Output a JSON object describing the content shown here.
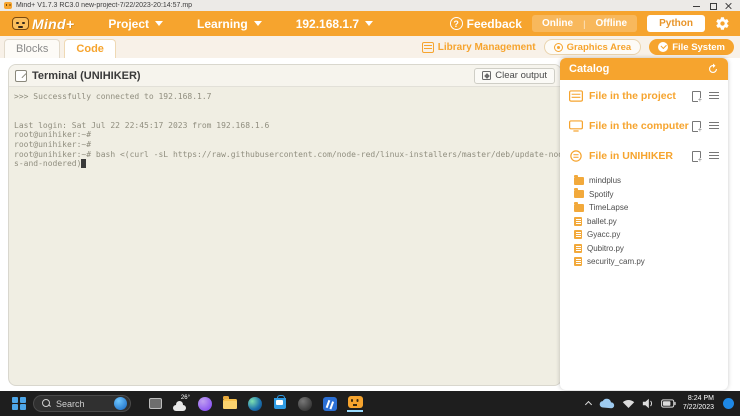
{
  "window": {
    "title": "Mind+ V1.7.3 RC3.0   new-project-7/22/2023-20:14:57.mp"
  },
  "header": {
    "logo_text": "Mind+",
    "menus": [
      {
        "label": "Project"
      },
      {
        "label": "Learning"
      },
      {
        "label": "192.168.1.7"
      }
    ],
    "feedback_label": "Feedback",
    "mode_toggle": {
      "online": "Online",
      "divider": "|",
      "offline": "Offline",
      "python": "Python"
    }
  },
  "tabs": {
    "blocks": "Blocks",
    "code": "Code"
  },
  "toolbar": {
    "library_management": "Library Management",
    "graphics_area": "Graphics Area",
    "file_system": "File System"
  },
  "terminal": {
    "title": "Terminal (UNIHIKER)",
    "clear_button": "Clear output",
    "lines": [
      ">>> Successfully connected to 192.168.1.7",
      "",
      "",
      "Last login: Sat Jul 22 22:45:17 2023 from 192.168.1.6",
      "root@unihiker:~#",
      "root@unihiker:~#",
      "root@unihiker:~# bash <(curl -sL https://raw.githubusercontent.com/node-red/linux-installers/master/deb/update-nodej",
      "s-and-nodered)"
    ]
  },
  "catalog": {
    "title": "Catalog",
    "sections": [
      {
        "label": "File in the project"
      },
      {
        "label": "File in the computer"
      },
      {
        "label": "File in UNIHIKER"
      }
    ],
    "files": [
      {
        "name": "mindplus",
        "type": "folder"
      },
      {
        "name": "Spotify",
        "type": "folder"
      },
      {
        "name": "TimeLapse",
        "type": "folder"
      },
      {
        "name": "ballet.py",
        "type": "file"
      },
      {
        "name": "Gyacc.py",
        "type": "file"
      },
      {
        "name": "Qubitro.py",
        "type": "file"
      },
      {
        "name": "security_cam.py",
        "type": "file"
      }
    ]
  },
  "taskbar": {
    "search_label": "Search",
    "weather_temp": "26°",
    "time": "8:24 PM",
    "date": "7/22/2023"
  },
  "colors": {
    "accent_orange": "#F6A42E",
    "accent_orange_light": "#F8B85C",
    "terminal_bg": "#F0EEE3",
    "terminal_text": "#908E7F",
    "taskbar_bg": "#1E1E1E"
  }
}
